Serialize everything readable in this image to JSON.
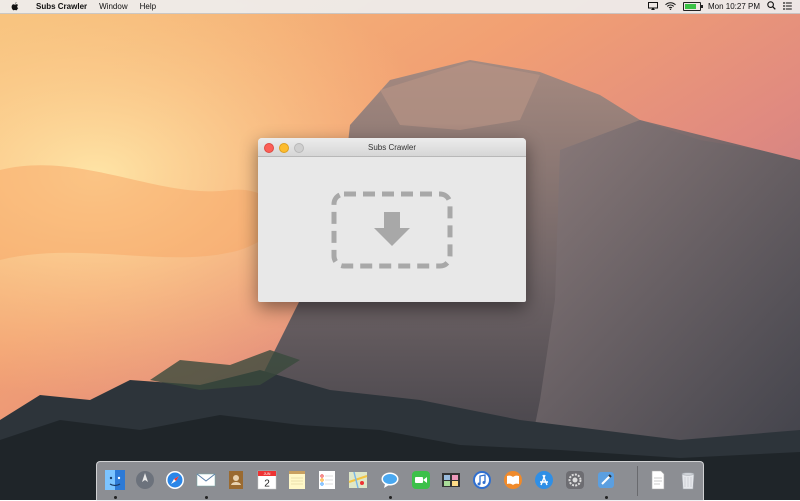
{
  "menubar": {
    "apple_icon": "apple-logo-icon",
    "app_name": "Subs Crawler",
    "menus": [
      "Window",
      "Help"
    ],
    "clock": "Mon 10:27 PM",
    "battery_level": 0.85,
    "status_icons": [
      "airplay-icon",
      "wifi-icon",
      "battery-icon",
      "spotlight-icon",
      "notification-center-icon"
    ]
  },
  "window": {
    "title": "Subs Crawler",
    "dropzone_icon": "download-dropzone-icon"
  },
  "dock": {
    "apps": [
      {
        "name": "finder-icon",
        "color": "#3b8de3",
        "running": true
      },
      {
        "name": "launchpad-icon",
        "color": "#8a8f99",
        "running": false
      },
      {
        "name": "safari-icon",
        "color": "#2a86e8",
        "running": false
      },
      {
        "name": "mail-icon",
        "color": "#5aa0d8",
        "running": true
      },
      {
        "name": "contacts-icon",
        "color": "#b07a3a",
        "running": false
      },
      {
        "name": "calendar-icon",
        "color": "#ffffff",
        "running": false
      },
      {
        "name": "notes-icon",
        "color": "#f7e27a",
        "running": false
      },
      {
        "name": "reminders-icon",
        "color": "#f5f5f5",
        "running": false
      },
      {
        "name": "maps-icon",
        "color": "#7fc26b",
        "running": false
      },
      {
        "name": "messages-icon",
        "color": "#4aa8f0",
        "running": true
      },
      {
        "name": "facetime-icon",
        "color": "#3cc04a",
        "running": false
      },
      {
        "name": "photo-booth-icon",
        "color": "#6b7a8a",
        "running": false
      },
      {
        "name": "itunes-icon",
        "color": "#3a7fd8",
        "running": false
      },
      {
        "name": "ibooks-icon",
        "color": "#f08a2a",
        "running": false
      },
      {
        "name": "app-store-icon",
        "color": "#2f8fe6",
        "running": false
      },
      {
        "name": "system-preferences-icon",
        "color": "#7d7d82",
        "running": false
      },
      {
        "name": "xcode-icon",
        "color": "#5b9fe0",
        "running": true
      },
      {
        "name": "document-icon",
        "color": "#f0f0f0",
        "running": false
      },
      {
        "name": "trash-icon",
        "color": "#d8dbe0",
        "running": false
      }
    ],
    "calendar": {
      "month": "JUN",
      "day": "2"
    }
  }
}
